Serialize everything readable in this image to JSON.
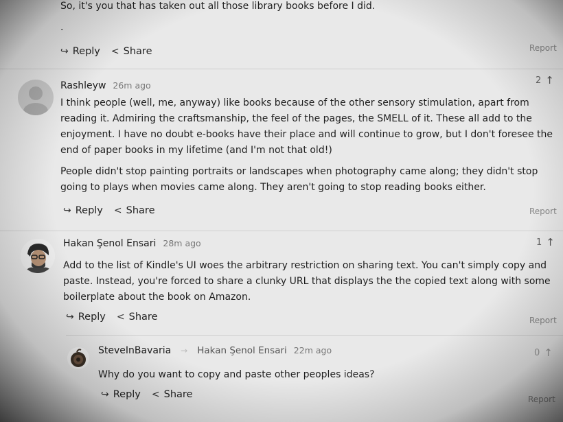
{
  "comment0": {
    "text": "So, it's you that has taken out all those library books before I did.",
    "extra": ".",
    "reply_label": "Reply",
    "share_label": "Share",
    "report_label": "Report"
  },
  "comment1": {
    "author": "Rashleyw",
    "time": "26m ago",
    "votes": "2",
    "paragraphs": [
      "I think people (well, me, anyway) like books because of the other sensory stimulation, apart from reading it. Admiring the craftsmanship, the feel of the pages, the SMELL of it. These all add to the enjoyment. I have no doubt e-books have their place and will continue to grow, but I don't foresee the end of paper books in my lifetime (and I'm not that old!)",
      "People didn't stop painting portraits or landscapes when photography came along; they didn't stop going to plays when movies came along. They aren't going to stop reading books either."
    ],
    "reply_label": "Reply",
    "share_label": "Share",
    "report_label": "Report"
  },
  "comment2": {
    "author": "Hakan Şenol Ensari",
    "time": "28m ago",
    "votes": "1",
    "text": "Add to the list of Kindle's UI woes the arbitrary restriction on sharing text. You can't simply copy and paste. Instead, you're forced to share a clunky URL that displays the the copied text along with some boilerplate about the book on Amazon.",
    "reply_label": "Reply",
    "share_label": "Share",
    "report_label": "Report"
  },
  "comment3": {
    "author": "SteveInBavaria",
    "reply_to": "Hakan Şenol Ensari",
    "time": "22m ago",
    "votes": "0",
    "text": "Why do you want to copy and paste other peoples ideas?",
    "reply_label": "Reply",
    "share_label": "Share",
    "report_label": "Report"
  },
  "icons": {
    "reply": "reply-arrow-icon",
    "share": "share-icon",
    "upvote": "upvote-arrow-icon"
  }
}
